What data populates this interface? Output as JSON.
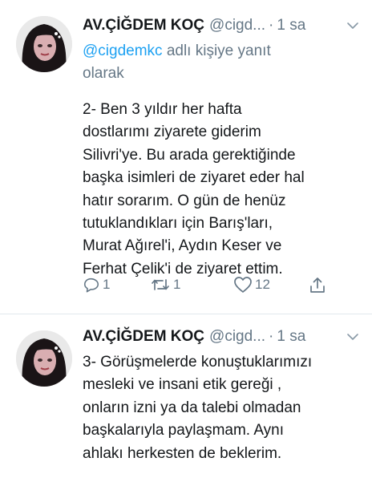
{
  "tweets": [
    {
      "author_name": "AV.ÇİĞDEM KOÇ",
      "handle": "@cigd...",
      "separator": "·",
      "time": "1 sa",
      "reply_mention": "@cigdemkc",
      "reply_suffix": "adlı kişiye yanıt olarak",
      "text_lines": [
        "2- Ben 3 yıldır her hafta",
        "dostlarımı ziyarete giderim",
        "Silivri'ye. Bu arada gerektiğinde",
        "başka isimleri de ziyaret eder hal",
        "hatır sorarım. O gün de henüz",
        "tutuklandıkları için Barış'ları,",
        "Murat Ağırel'i, Aydın Keser ve",
        "Ferhat Çelik'i de ziyaret ettim."
      ],
      "actions": {
        "replies": "1",
        "retweets": "1",
        "likes": "12"
      }
    },
    {
      "author_name": "AV.ÇİĞDEM KOÇ",
      "handle": "@cigd...",
      "separator": "·",
      "time": "1 sa",
      "text_lines": [
        "3- Görüşmelerde konuştuklarımızı",
        "mesleki ve insani etik gereği ,",
        "onların izni ya da talebi olmadan",
        "başkalarıyla paylaşmam. Aynı",
        "ahlakı herkesten de beklerim."
      ]
    }
  ],
  "colors": {
    "accent": "#1da1f2",
    "secondary_text": "#657786",
    "primary_text": "#14171a"
  },
  "icons": [
    "reply-icon",
    "retweet-icon",
    "like-icon",
    "share-icon",
    "chevron-down-icon"
  ]
}
